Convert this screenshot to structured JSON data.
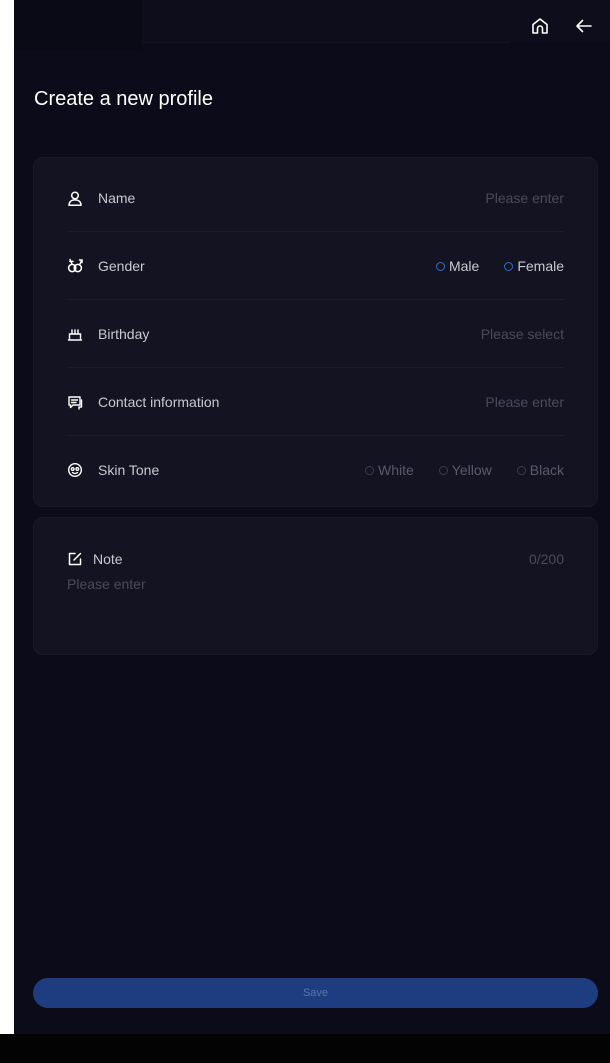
{
  "header": {
    "title": "Create a new profile",
    "home_icon": "home-icon",
    "back_icon": "arrow-left-icon"
  },
  "form": {
    "name": {
      "label": "Name",
      "placeholder": "Please enter",
      "icon": "person-icon"
    },
    "gender": {
      "label": "Gender",
      "icon": "gender-icon",
      "options": [
        "Male",
        "Female"
      ]
    },
    "birthday": {
      "label": "Birthday",
      "placeholder": "Please select",
      "icon": "cake-icon"
    },
    "contact": {
      "label": "Contact information",
      "placeholder": "Please enter",
      "icon": "chat-icon"
    },
    "skin_tone": {
      "label": "Skin Tone",
      "icon": "face-icon",
      "options": [
        "White",
        "Yellow",
        "Black"
      ]
    }
  },
  "note": {
    "label": "Note",
    "counter": "0/200",
    "placeholder": "Please enter",
    "icon": "edit-icon"
  },
  "save_label": "Save",
  "colors": {
    "background": "#0b0b1a",
    "card": "#131322",
    "accent": "#2f6fd0",
    "button": "#1d3d80"
  }
}
